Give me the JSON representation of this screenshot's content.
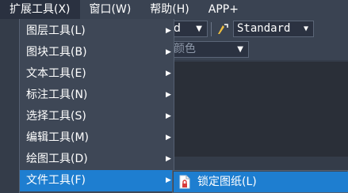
{
  "menubar": {
    "items": [
      {
        "label": "扩展工具(X)",
        "active": true
      },
      {
        "label": "窗口(W)",
        "active": false
      },
      {
        "label": "帮助(H)",
        "active": false
      },
      {
        "label": "APP+",
        "active": false
      }
    ]
  },
  "toolbar": {
    "combo_left_value": "d",
    "text_style_value": "Standard",
    "color_combo_value": "颜色"
  },
  "dropdown": {
    "items": [
      {
        "label": "图层工具(L)",
        "has_submenu": true
      },
      {
        "label": "图块工具(B)",
        "has_submenu": true
      },
      {
        "label": "文本工具(E)",
        "has_submenu": true
      },
      {
        "label": "标注工具(N)",
        "has_submenu": true
      },
      {
        "label": "选择工具(S)",
        "has_submenu": true
      },
      {
        "label": "编辑工具(M)",
        "has_submenu": true
      },
      {
        "label": "绘图工具(D)",
        "has_submenu": true
      },
      {
        "label": "文件工具(F)",
        "has_submenu": true
      }
    ],
    "selected_label": "文件工具(F)"
  },
  "submenu": {
    "items": [
      {
        "label": "锁定图纸(L)",
        "icon": "lock-drawing-icon"
      }
    ]
  },
  "colors": {
    "menubar_bg": "#3a4352",
    "menu_bg": "#3e4756",
    "highlight": "#1e7ed0",
    "text": "#ffffff"
  }
}
